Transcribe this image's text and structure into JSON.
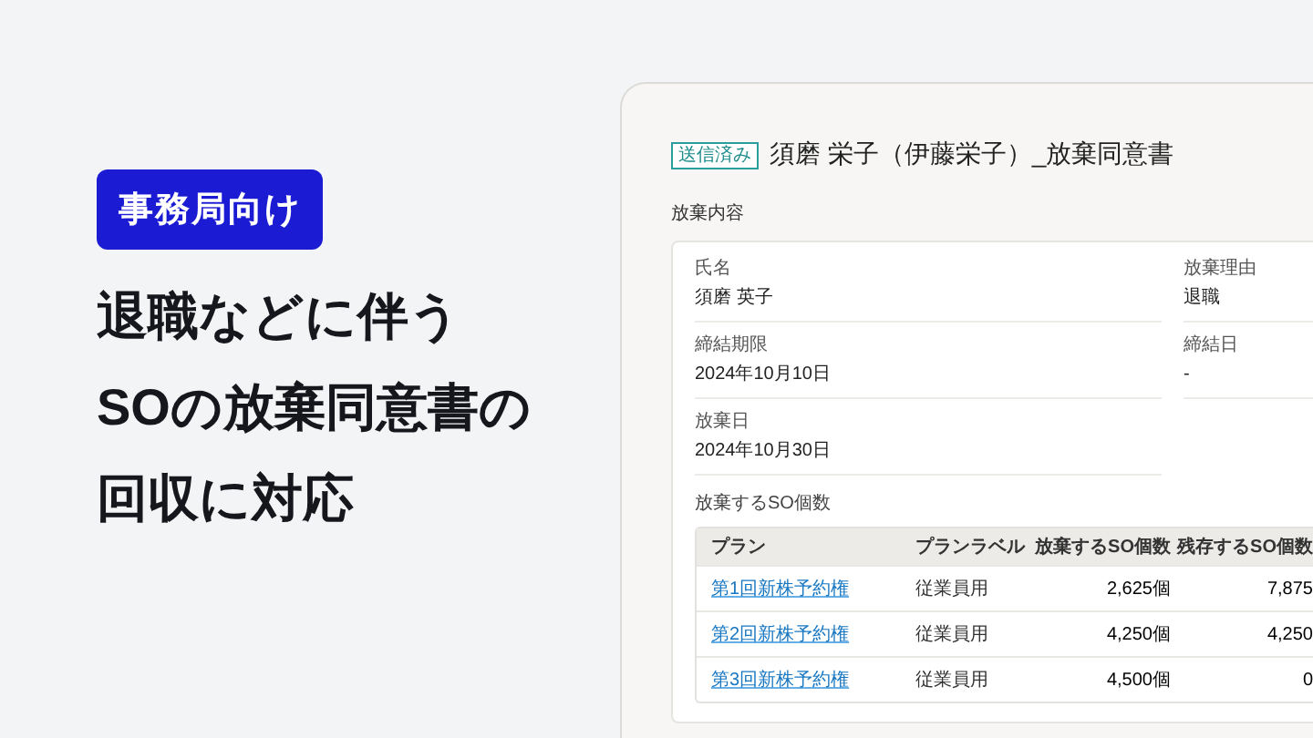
{
  "promo": {
    "badge": "事務局向け",
    "headline": [
      "退職などに伴う",
      "SOの放棄同意書の",
      "回収に対応"
    ]
  },
  "document": {
    "status": "送信済み",
    "title": "須磨 栄子（伊藤栄子）_放棄同意書",
    "section": "放棄内容",
    "fields": [
      {
        "label": "氏名",
        "value": "須磨 英子"
      },
      {
        "label": "放棄理由",
        "value": "退職"
      },
      {
        "label": "締結期限",
        "value": "2024年10月10日"
      },
      {
        "label": "締結日",
        "value": "-"
      },
      {
        "label": "放棄日",
        "value": "2024年10月30日"
      }
    ],
    "table_title": "放棄するSO個数",
    "table": {
      "columns": [
        "プラン",
        "プランラベル",
        "放棄するSO個数",
        "残存するSO個数"
      ],
      "rows": [
        {
          "plan": "第1回新株予約権",
          "label": "従業員用",
          "waived": "2,625個",
          "remaining": "7,875"
        },
        {
          "plan": "第2回新株予約権",
          "label": "従業員用",
          "waived": "4,250個",
          "remaining": "4,250"
        },
        {
          "plan": "第3回新株予約権",
          "label": "従業員用",
          "waived": "4,500個",
          "remaining": "0"
        }
      ]
    }
  }
}
